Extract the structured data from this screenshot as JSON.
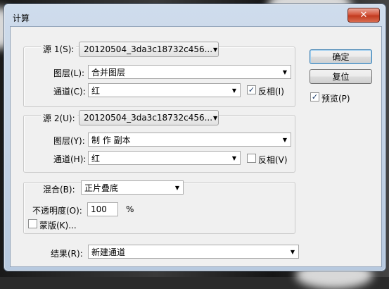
{
  "window": {
    "title": "计算",
    "close_label": "✕"
  },
  "source1": {
    "label": "源 1(S):",
    "value": "20120504_3da3c18732c456...",
    "layer_label": "图层(L):",
    "layer_value": "合并图层",
    "channel_label": "通道(C):",
    "channel_value": "红",
    "invert_label": "反相(I)",
    "invert_checked": true
  },
  "source2": {
    "label": "源 2(U):",
    "value": "20120504_3da3c18732c456...",
    "layer_label": "图层(Y):",
    "layer_value": "制 作 副本",
    "channel_label": "通道(H):",
    "channel_value": "红",
    "invert_label": "反相(V)",
    "invert_checked": false
  },
  "blend": {
    "label": "混合(B):",
    "mode_value": "正片叠底",
    "opacity_label": "不透明度(O):",
    "opacity_value": "100",
    "opacity_unit": "%",
    "mask_label": "蒙版(K)...",
    "mask_checked": false
  },
  "result": {
    "label": "结果(R):",
    "value": "新建通道"
  },
  "buttons": {
    "ok": "确定",
    "reset": "复位"
  },
  "preview": {
    "label": "预览(P)",
    "checked": true
  }
}
